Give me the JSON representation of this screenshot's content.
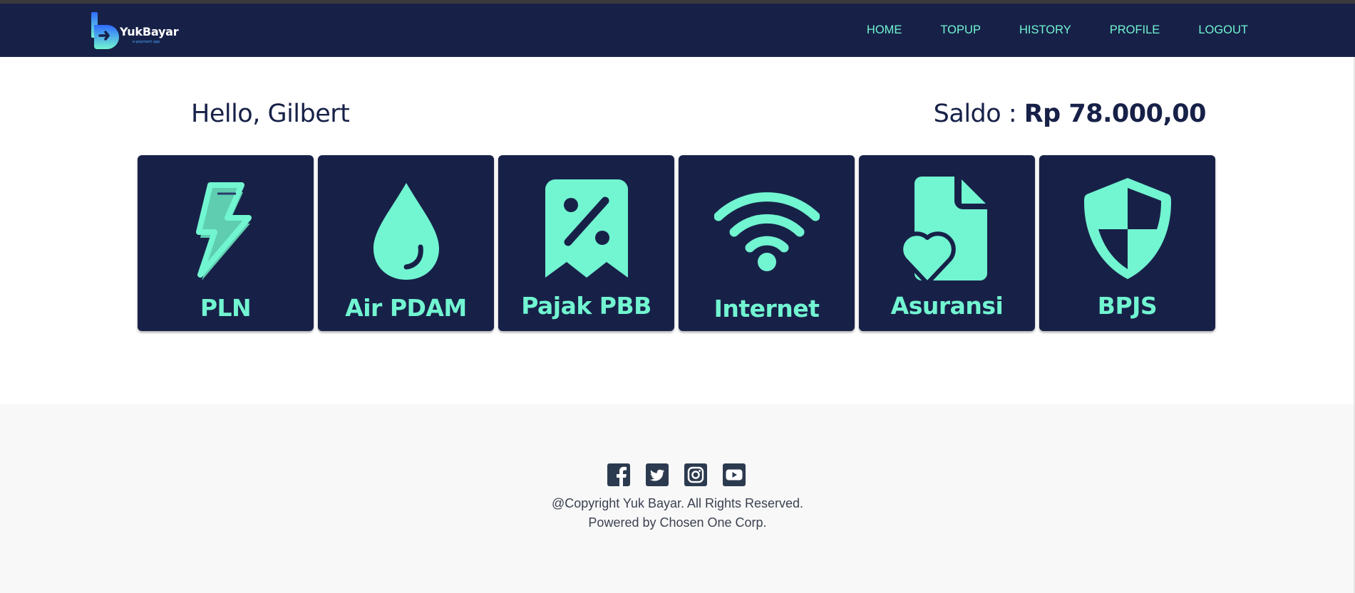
{
  "brand": {
    "name": "YukBayar",
    "tagline": "e-payment app",
    "logo_icon": "b-arrow-logo-icon"
  },
  "nav": {
    "items": [
      {
        "label": "HOME"
      },
      {
        "label": "TOPUP"
      },
      {
        "label": "HISTORY"
      },
      {
        "label": "PROFILE"
      },
      {
        "label": "LOGOUT"
      }
    ]
  },
  "greeting": {
    "text": "Hello, Gilbert"
  },
  "balance": {
    "label": "Saldo : ",
    "amount": "Rp 78.000,00"
  },
  "services": [
    {
      "label": "PLN",
      "icon": "lightning-icon"
    },
    {
      "label": "Air PDAM",
      "icon": "water-drop-icon"
    },
    {
      "label": "Pajak PBB",
      "icon": "tax-receipt-icon"
    },
    {
      "label": "Internet",
      "icon": "wifi-icon"
    },
    {
      "label": "Asuransi",
      "icon": "insurance-document-heart-icon"
    },
    {
      "label": "BPJS",
      "icon": "shield-icon"
    }
  ],
  "footer": {
    "socials": [
      {
        "icon": "facebook-icon"
      },
      {
        "icon": "twitter-icon"
      },
      {
        "icon": "instagram-icon"
      },
      {
        "icon": "youtube-icon"
      }
    ],
    "copyright": "@Copyright Yuk Bayar. All Rights Reserved.",
    "powered": "Powered by Chosen One Corp."
  },
  "colors": {
    "navy": "#172148",
    "accent": "#72f5d1",
    "footer_bg": "#f8f8f8"
  }
}
